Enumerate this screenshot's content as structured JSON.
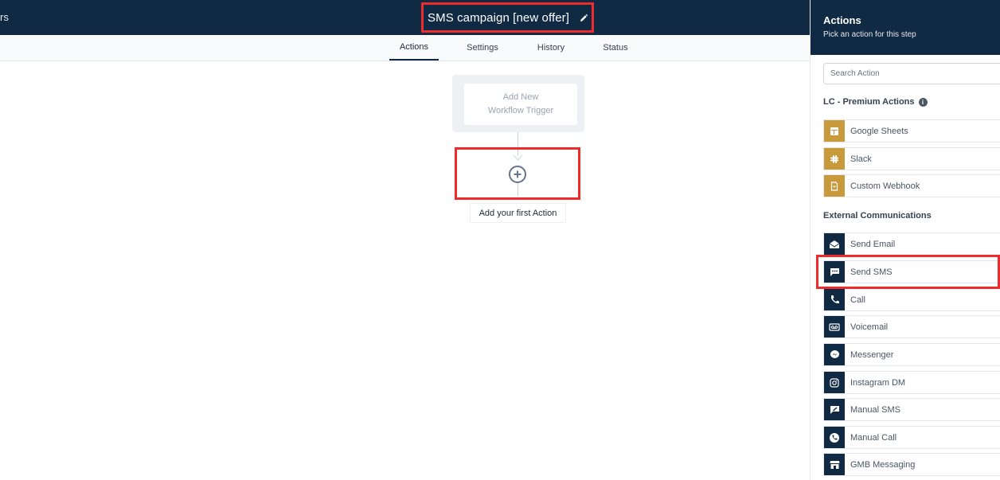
{
  "header": {
    "back_text": "rs",
    "workflow_title": "SMS campaign [new offer]",
    "edit_icon": "pencil-icon"
  },
  "tabs": [
    {
      "label": "Actions",
      "active": true
    },
    {
      "label": "Settings",
      "active": false
    },
    {
      "label": "History",
      "active": false
    },
    {
      "label": "Status",
      "active": false
    }
  ],
  "canvas": {
    "trigger_line1": "Add New",
    "trigger_line2": "Workflow Trigger",
    "first_action_label": "Add your first Action",
    "add_icon": "plus-circle-icon"
  },
  "panel": {
    "title": "Actions",
    "subtitle": "Pick an action for this step",
    "search_placeholder": "Search Action",
    "premium_section": "LC - Premium Actions",
    "premium_actions": [
      {
        "label": "Google Sheets",
        "icon": "google-sheets-icon"
      },
      {
        "label": "Slack",
        "icon": "slack-icon"
      },
      {
        "label": "Custom Webhook",
        "icon": "webhook-icon"
      }
    ],
    "external_section": "External Communications",
    "external_actions": [
      {
        "label": "Send Email",
        "icon": "email-icon"
      },
      {
        "label": "Send SMS",
        "icon": "sms-icon"
      },
      {
        "label": "Call",
        "icon": "phone-icon"
      },
      {
        "label": "Voicemail",
        "icon": "voicemail-icon"
      },
      {
        "label": "Messenger",
        "icon": "messenger-icon"
      },
      {
        "label": "Instagram DM",
        "icon": "instagram-icon"
      },
      {
        "label": "Manual SMS",
        "icon": "manual-sms-icon"
      },
      {
        "label": "Manual Call",
        "icon": "manual-call-icon"
      },
      {
        "label": "GMB Messaging",
        "icon": "gmb-icon"
      }
    ]
  },
  "colors": {
    "navy": "#102a43",
    "gold": "#c89a3c",
    "highlight_red": "#ef2b2b"
  }
}
